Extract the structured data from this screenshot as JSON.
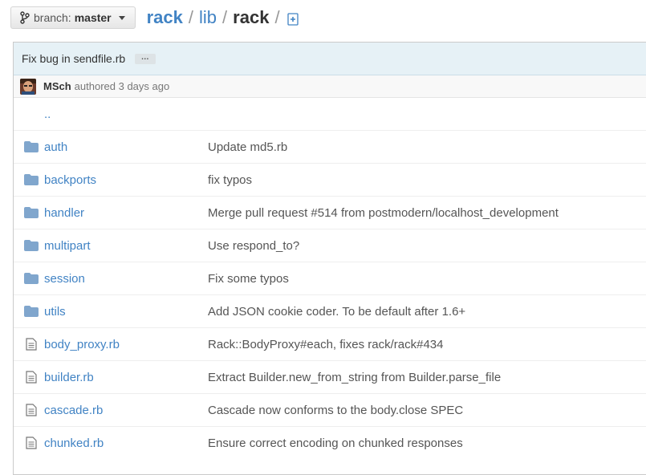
{
  "branch": {
    "prefix": "branch:",
    "name": "master"
  },
  "breadcrumb": {
    "root": "rack",
    "sep1": "/",
    "middle": "lib",
    "sep2": "/",
    "current": "rack",
    "sep3": "/"
  },
  "commit": {
    "title": "Fix bug in sendfile.rb",
    "ellipsis": "…",
    "author": "MSch",
    "meta": "authored 3 days ago"
  },
  "files": {
    "parent": "..",
    "items": [
      {
        "type": "folder",
        "name": "auth",
        "message": "Update md5.rb"
      },
      {
        "type": "folder",
        "name": "backports",
        "message": "fix typos"
      },
      {
        "type": "folder",
        "name": "handler",
        "message": "Merge pull request #514 from postmodern/localhost_development"
      },
      {
        "type": "folder",
        "name": "multipart",
        "message": "Use respond_to?"
      },
      {
        "type": "folder",
        "name": "session",
        "message": "Fix some typos"
      },
      {
        "type": "folder",
        "name": "utils",
        "message": "Add JSON cookie coder. To be default after 1.6+"
      },
      {
        "type": "file",
        "name": "body_proxy.rb",
        "message": "Rack::BodyProxy#each, fixes rack/rack#434"
      },
      {
        "type": "file",
        "name": "builder.rb",
        "message": "Extract Builder.new_from_string from Builder.parse_file"
      },
      {
        "type": "file",
        "name": "cascade.rb",
        "message": "Cascade now conforms to the body.close SPEC"
      },
      {
        "type": "file",
        "name": "chunked.rb",
        "message": "Ensure correct encoding on chunked responses"
      }
    ]
  },
  "colors": {
    "link": "#4183c4",
    "folder": "#80a6cd",
    "commit_bar": "#e6f1f6"
  }
}
